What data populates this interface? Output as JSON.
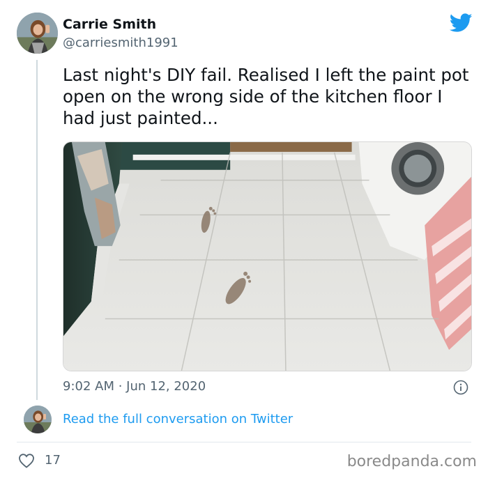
{
  "tweet": {
    "author": {
      "display_name": "Carrie Smith",
      "handle": "@carriesmith1991"
    },
    "text": "Last night's DIY fail. Realised I left the paint pot open on the wrong side of the kitchen floor I had just painted...",
    "timestamp": "9:02 AM · Jun 12, 2020",
    "read_link": "Read the full conversation on Twitter",
    "like_count": "17"
  },
  "icons": {
    "platform": "twitter-bird-icon",
    "info": "info-icon",
    "like": "heart-icon"
  },
  "colors": {
    "link_blue": "#1d9bf0",
    "secondary_text": "#536471",
    "twitter_blue": "#1d9bf0"
  },
  "watermark": "boredpanda.com"
}
